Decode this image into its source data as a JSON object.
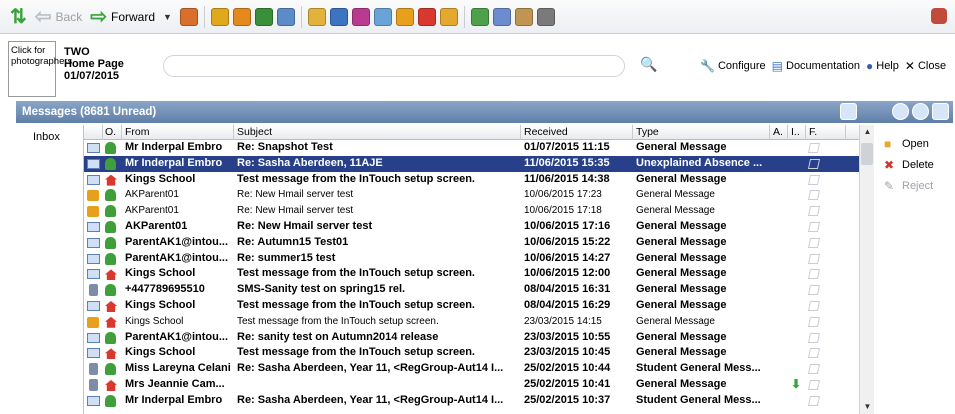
{
  "toolbar": {
    "back_label": "Back",
    "forward_label": "Forward",
    "module_icons": [
      "#d96f2a",
      "#e0a91b",
      "#e48a1c",
      "#3a8f3a",
      "#5b8cc9",
      "#e2b23b",
      "#3d74c2",
      "#b83b8f",
      "#6aa3d8",
      "#e89f1c",
      "#d9382f",
      "#e5a82e",
      "#4ea04a",
      "#6c8ccf",
      "#c09554",
      "#7a7a7a"
    ]
  },
  "header": {
    "photo_text": "Click for photographers.",
    "user_name": "TWO",
    "page_name": "Home Page",
    "date": "01/07/2015",
    "configure_label": "Configure",
    "documentation_label": "Documentation",
    "help_label": "Help",
    "close_label": "Close"
  },
  "messages": {
    "panel_title": "Messages (8681 Unread)",
    "folder": "Inbox",
    "columns": {
      "o": "O.",
      "from": "From",
      "subject": "Subject",
      "received": "Received",
      "type": "Type",
      "a": "A.",
      "i": "I..",
      "f": "F."
    },
    "rows": [
      {
        "icon": "env",
        "sender": "person",
        "from": "Mr Inderpal Embro",
        "subject": "Re: Snapshot Test",
        "received": "01/07/2015 11:15",
        "type": "General Message",
        "style": "bold"
      },
      {
        "icon": "env",
        "sender": "person",
        "from": "Mr Inderpal Embro",
        "subject": "Re: Sasha Aberdeen, 11AJE",
        "received": "11/06/2015 15:35",
        "type": "Unexplained Absence ...",
        "style": "selected"
      },
      {
        "icon": "env",
        "sender": "house",
        "from": "Kings School",
        "subject": "Test message from the InTouch setup screen.",
        "received": "11/06/2015 14:38",
        "type": "General Message",
        "style": "bold"
      },
      {
        "icon": "parent",
        "sender": "person",
        "from": "AKParent01",
        "subject": "Re: New Hmail server test",
        "received": "10/06/2015 17:23",
        "type": "General Message",
        "style": "normal"
      },
      {
        "icon": "parent",
        "sender": "person",
        "from": "AKParent01",
        "subject": "Re: New Hmail server test",
        "received": "10/06/2015 17:18",
        "type": "General Message",
        "style": "normal"
      },
      {
        "icon": "env",
        "sender": "person",
        "from": "AKParent01",
        "subject": "Re: New Hmail server test",
        "received": "10/06/2015 17:16",
        "type": "General Message",
        "style": "bold"
      },
      {
        "icon": "env",
        "sender": "person",
        "from": "ParentAK1@intou...",
        "subject": "Re: Autumn15 Test01",
        "received": "10/06/2015 15:22",
        "type": "General Message",
        "style": "bold"
      },
      {
        "icon": "env",
        "sender": "person",
        "from": "ParentAK1@intou...",
        "subject": "Re: summer15 test",
        "received": "10/06/2015 14:27",
        "type": "General Message",
        "style": "bold"
      },
      {
        "icon": "env",
        "sender": "house",
        "from": "Kings School",
        "subject": "Test message from the InTouch setup screen.",
        "received": "10/06/2015 12:00",
        "type": "General Message",
        "style": "bold"
      },
      {
        "icon": "phone",
        "sender": "person",
        "from": "+447789695510",
        "subject": "SMS-Sanity test on spring15 rel.",
        "received": "08/04/2015 16:31",
        "type": "General Message",
        "style": "bold"
      },
      {
        "icon": "env",
        "sender": "house",
        "from": "Kings School",
        "subject": "Test message from the InTouch setup screen.",
        "received": "08/04/2015 16:29",
        "type": "General Message",
        "style": "bold"
      },
      {
        "icon": "parent",
        "sender": "house",
        "from": "Kings School",
        "subject": "Test message from the InTouch setup screen.",
        "received": "23/03/2015 14:15",
        "type": "General Message",
        "style": "normal"
      },
      {
        "icon": "env",
        "sender": "person",
        "from": "ParentAK1@intou...",
        "subject": "Re: sanity test on Autumn2014 release",
        "received": "23/03/2015 10:55",
        "type": "General Message",
        "style": "bold"
      },
      {
        "icon": "env",
        "sender": "house",
        "from": "Kings School",
        "subject": "Test message from the InTouch setup screen.",
        "received": "23/03/2015 10:45",
        "type": "General Message",
        "style": "bold"
      },
      {
        "icon": "phone",
        "sender": "person",
        "from": "Miss Lareyna Celani",
        "subject": "Re: Sasha Aberdeen, Year 11, <RegGroup-Aut14 I...",
        "received": "25/02/2015 10:44",
        "type": "Student General Mess...",
        "style": "bold"
      },
      {
        "icon": "phone",
        "sender": "house",
        "from": "Mrs Jeannie Cam...",
        "subject": "",
        "received": "25/02/2015 10:41",
        "type": "General Message",
        "style": "bold",
        "attachment": true
      },
      {
        "icon": "env",
        "sender": "person",
        "from": "Mr Inderpal Embro",
        "subject": "Re: Sasha Aberdeen, Year 11, <RegGroup-Aut14 I...",
        "received": "25/02/2015 10:37",
        "type": "Student General Mess...",
        "style": "bold"
      }
    ]
  },
  "actions": {
    "open_label": "Open",
    "delete_label": "Delete",
    "reject_label": "Reject"
  }
}
